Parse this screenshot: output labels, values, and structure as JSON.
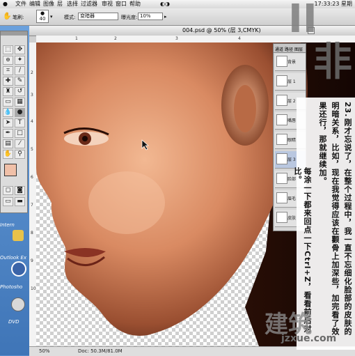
{
  "menubar": {
    "items": [
      "文件",
      "编辑",
      "图像",
      "层",
      "选择",
      "过滤器",
      "审视",
      "窗口",
      "帮助"
    ],
    "clock": "17:33:23 星期"
  },
  "options": {
    "brush_label": "笔刷:",
    "brush_size": "40",
    "mode_label": "模式:",
    "mode_value": "变暗器",
    "exposure_label": "曝光度:",
    "exposure_value": "10%"
  },
  "document": {
    "title": "004.psd @ 50% (层 3,CMYK)",
    "zoom": "50%",
    "doc_size": "Doc: 50.3M/81.0M"
  },
  "desktop": {
    "icons": [
      {
        "name": "internet-icon",
        "label": "Intern"
      },
      {
        "name": "outlook-icon",
        "label": "Outlook Ex"
      },
      {
        "name": "photoshop-icon",
        "label": "Photosho"
      },
      {
        "name": "dvd-icon",
        "label": "DVD"
      }
    ]
  },
  "layers": {
    "tabs": [
      "通道",
      "路径",
      "图层"
    ],
    "rows": [
      "背景",
      "层 1",
      "层 2",
      "嘴唇",
      "眼睛",
      "层 3",
      "脸部",
      "眉毛",
      "皮肤"
    ]
  },
  "tutorial": {
    "step": "23.",
    "lines": [
      "刚才忘说了，在整个过程中，我一直不忘细化脸部的皮肤的",
      "明暗关系，比如，现在我觉得应该在颧骨上加深些，加完看了效",
      "果还行，那就继续加。",
      "每涂一下都来回点一下Ctrl+Z，看看前后对比。"
    ]
  },
  "watermark": {
    "big_left": "II",
    "big_right": "非",
    "brand": "建筑",
    "url": "jzxue.com"
  }
}
